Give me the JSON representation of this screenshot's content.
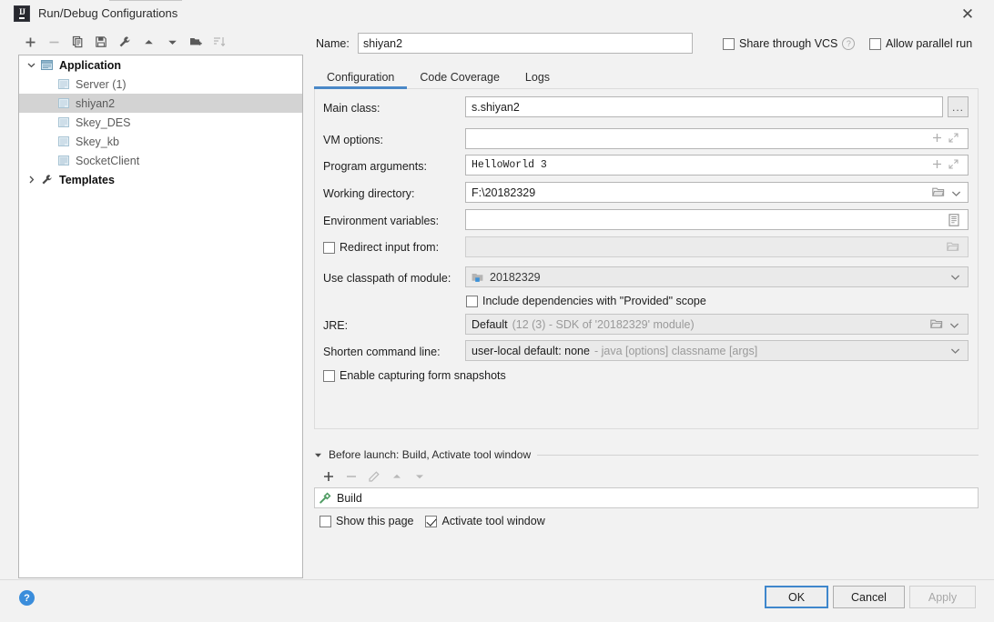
{
  "window": {
    "title": "Run/Debug Configurations",
    "app_icon": "intellij-idea-icon",
    "close_label": "✕"
  },
  "tree_toolbar": {
    "buttons": [
      {
        "name": "add-configuration-button",
        "icon": "plus-icon",
        "label": "+",
        "enabled": true
      },
      {
        "name": "remove-configuration-button",
        "icon": "minus-icon",
        "label": "−",
        "enabled": false
      },
      {
        "name": "copy-configuration-button",
        "icon": "copy-icon",
        "label": "Copy",
        "enabled": true
      },
      {
        "name": "save-configuration-button",
        "icon": "save-icon",
        "label": "Save",
        "enabled": true
      },
      {
        "name": "edit-templates-button",
        "icon": "wrench-icon",
        "label": "Edit defaults",
        "enabled": true
      },
      {
        "name": "move-up-button",
        "icon": "arrow-up-icon",
        "label": "Move Up",
        "enabled": true
      },
      {
        "name": "move-down-button",
        "icon": "arrow-down-icon",
        "label": "Move Down",
        "enabled": true
      },
      {
        "name": "new-folder-button",
        "icon": "folder-add-icon",
        "label": "New Folder",
        "enabled": true
      },
      {
        "name": "sort-configurations-button",
        "icon": "sort-icon",
        "label": "Sort",
        "enabled": false
      }
    ]
  },
  "tree": {
    "nodes": [
      {
        "label": "Application",
        "icon": "application-icon",
        "level": 0,
        "expanded": true,
        "bold": true,
        "selected": false
      },
      {
        "label": "Server (1)",
        "icon": "run-config-icon",
        "level": 1,
        "bold": false,
        "selected": false
      },
      {
        "label": "shiyan2",
        "icon": "run-config-icon",
        "level": 1,
        "bold": false,
        "selected": true
      },
      {
        "label": "Skey_DES",
        "icon": "run-config-icon",
        "level": 1,
        "bold": false,
        "selected": false
      },
      {
        "label": "Skey_kb",
        "icon": "run-config-icon",
        "level": 1,
        "bold": false,
        "selected": false
      },
      {
        "label": "SocketClient",
        "icon": "run-config-icon",
        "level": 1,
        "bold": false,
        "selected": false
      },
      {
        "label": "Templates",
        "icon": "wrench-icon",
        "level": 0,
        "expanded": false,
        "bold": true,
        "selected": false
      }
    ]
  },
  "header": {
    "name_label": "Name:",
    "name_value": "shiyan2",
    "share_vcs_label": "Share through VCS",
    "share_vcs_checked": false,
    "share_vcs_help_icon": "help-circle-icon",
    "allow_parallel_label": "Allow parallel run",
    "allow_parallel_checked": false
  },
  "tabs": {
    "items": [
      {
        "label": "Configuration",
        "active": true
      },
      {
        "label": "Code Coverage",
        "active": false
      },
      {
        "label": "Logs",
        "active": false
      }
    ]
  },
  "configuration": {
    "main_class": {
      "label": "Main class:",
      "value": "s.shiyan2",
      "browse_label": "..."
    },
    "vm_options": {
      "label": "VM options:",
      "value": "",
      "icons": [
        "plus-icon",
        "expand-icon"
      ]
    },
    "program_arguments": {
      "label": "Program arguments:",
      "value": "HelloWorld 3",
      "icons": [
        "plus-icon",
        "expand-icon"
      ]
    },
    "working_directory": {
      "label": "Working directory:",
      "value": "F:\\20182329",
      "icons": [
        "folder-icon",
        "chevron-down-icon"
      ]
    },
    "environment_variables": {
      "label": "Environment variables:",
      "value": "",
      "icons": [
        "list-icon"
      ]
    },
    "redirect_input": {
      "label": "Redirect input from:",
      "checked": false,
      "value": "",
      "icons": [
        "folder-icon"
      ]
    },
    "classpath_module": {
      "label": "Use classpath of module:",
      "value": "20182329",
      "icon": "module-icon",
      "icons": [
        "chevron-down-icon"
      ]
    },
    "include_provided": {
      "label": "Include dependencies with \"Provided\" scope",
      "checked": false
    },
    "jre": {
      "label": "JRE:",
      "value": "Default",
      "hint": "(12 (3) - SDK of '20182329' module)",
      "icons": [
        "folder-icon",
        "chevron-down-icon"
      ]
    },
    "shorten_command_line": {
      "label": "Shorten command line:",
      "value": "user-local default: none",
      "hint": "- java [options] classname [args]",
      "icons": [
        "chevron-down-icon"
      ]
    },
    "form_snapshots": {
      "label": "Enable capturing form snapshots",
      "checked": false
    }
  },
  "before_launch": {
    "title": "Before launch: Build, Activate tool window",
    "collapse_icon": "triangle-down-icon",
    "toolbar": [
      {
        "name": "add-task-button",
        "icon": "plus-icon",
        "label": "+",
        "enabled": true
      },
      {
        "name": "remove-task-button",
        "icon": "minus-icon",
        "label": "−",
        "enabled": false
      },
      {
        "name": "edit-task-button",
        "icon": "pencil-icon",
        "label": "Edit",
        "enabled": false
      },
      {
        "name": "task-move-up-button",
        "icon": "arrow-up-icon",
        "label": "Up",
        "enabled": false
      },
      {
        "name": "task-move-down-button",
        "icon": "arrow-down-icon",
        "label": "Down",
        "enabled": false
      }
    ],
    "items": [
      {
        "label": "Build",
        "icon": "build-hammer-icon"
      }
    ],
    "show_this_page": {
      "label": "Show this page",
      "checked": false
    },
    "activate_tool_window": {
      "label": "Activate tool window",
      "checked": true
    }
  },
  "footer": {
    "help_icon": "help-icon",
    "ok_label": "OK",
    "cancel_label": "Cancel",
    "apply_label": "Apply",
    "apply_enabled": false
  },
  "colors": {
    "accent_blue": "#4a88c7",
    "selection_gray": "#d3d3d3",
    "help_blue": "#3a8ddb",
    "build_green": "#4f9c63"
  }
}
